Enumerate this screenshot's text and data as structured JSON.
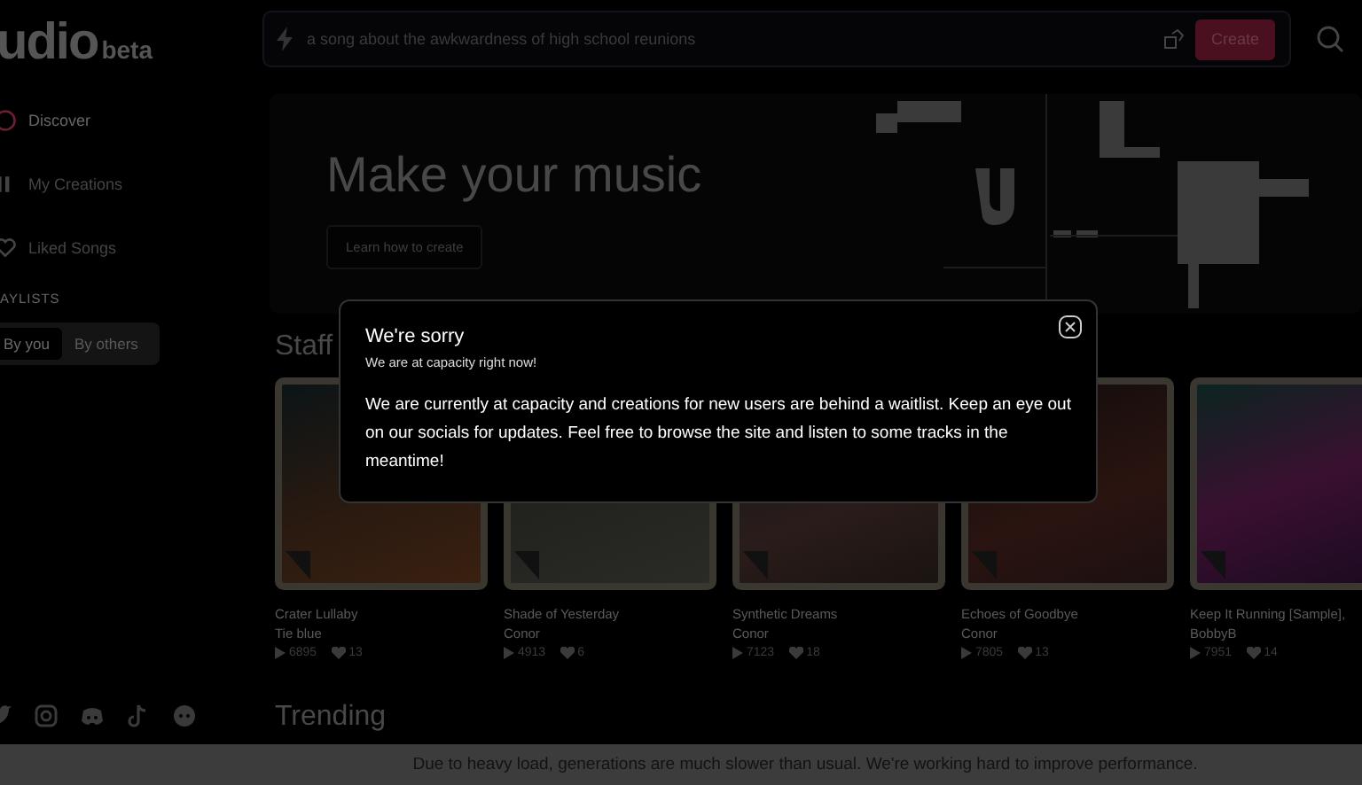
{
  "logo": {
    "text": "udio",
    "badge": "beta"
  },
  "sidebar": {
    "items": [
      {
        "label": "Discover",
        "selected": true
      },
      {
        "label": "My Creations",
        "selected": false
      },
      {
        "label": "Liked Songs",
        "selected": false
      }
    ],
    "section_title": "AYLISTS",
    "playlist_tabs": [
      {
        "label": "By you",
        "selected": true
      },
      {
        "label": "By others",
        "selected": false
      }
    ]
  },
  "prompt_bar": {
    "placeholder": "a song about the awkwardness of high school reunions",
    "button": "Create"
  },
  "hero": {
    "title": "Make your music",
    "button": "Learn how to create"
  },
  "sections": [
    {
      "title": "Staff",
      "cards": [
        {
          "title": "Crater Lullaby",
          "artist": "Tie blue",
          "plays": "6895",
          "likes": "13"
        },
        {
          "title": "Shade of Yesterday",
          "artist": "Conor",
          "plays": "4913",
          "likes": "6"
        },
        {
          "title": "Synthetic Dreams",
          "artist": "Conor",
          "plays": "7123",
          "likes": "18"
        },
        {
          "title": "Echoes of Goodbye",
          "artist": "Conor",
          "plays": "7805",
          "likes": "13"
        },
        {
          "title": "Keep It Running [Sample],",
          "artist": "BobbyB",
          "plays": "7951",
          "likes": "14"
        }
      ]
    },
    {
      "title": "Trending"
    }
  ],
  "modal": {
    "title": "We're sorry",
    "subtitle": "We are at capacity right now!",
    "body": "We are currently at capacity and creations for new users are behind a waitlist. Keep an eye out on our socials for updates. Feel free to browse the site and listen to some tracks in the meantime!"
  },
  "banner": "Due to heavy load, generations are much slower than usual. We're working hard to improve performance."
}
